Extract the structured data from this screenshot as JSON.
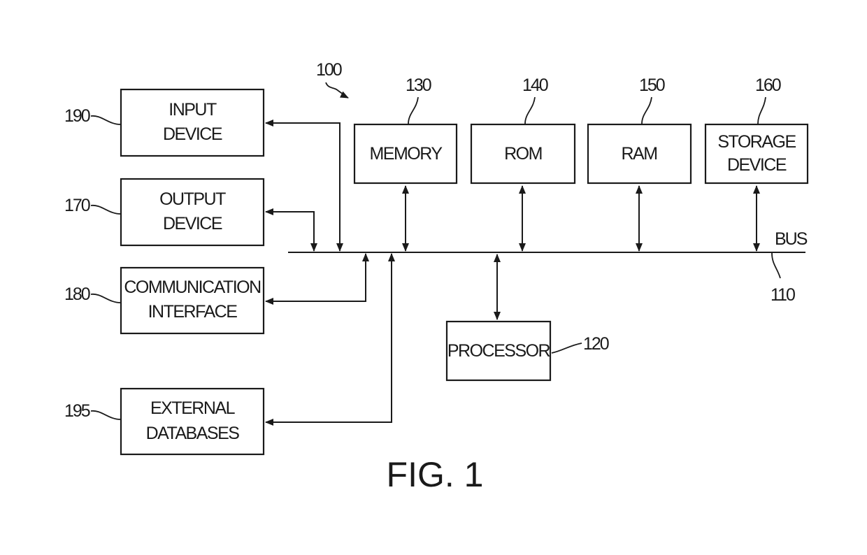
{
  "figure": {
    "caption": "FIG. 1",
    "system_ref": "100"
  },
  "bus": {
    "label": "BUS",
    "ref": "110"
  },
  "components": {
    "input_device": {
      "lines": [
        "INPUT",
        "DEVICE"
      ],
      "ref": "190"
    },
    "output_device": {
      "lines": [
        "OUTPUT",
        "DEVICE"
      ],
      "ref": "170"
    },
    "communication_interface": {
      "lines": [
        "COMMUNICATION",
        "INTERFACE"
      ],
      "ref": "180"
    },
    "external_databases": {
      "lines": [
        "EXTERNAL",
        "DATABASES"
      ],
      "ref": "195"
    },
    "memory": {
      "lines": [
        "MEMORY"
      ],
      "ref": "130"
    },
    "rom": {
      "lines": [
        "ROM"
      ],
      "ref": "140"
    },
    "ram": {
      "lines": [
        "RAM"
      ],
      "ref": "150"
    },
    "storage_device": {
      "lines": [
        "STORAGE",
        "DEVICE"
      ],
      "ref": "160"
    },
    "processor": {
      "lines": [
        "PROCESSOR"
      ],
      "ref": "120"
    }
  },
  "connections": [
    {
      "from": "input_device",
      "to": "bus",
      "direction": "bidirectional"
    },
    {
      "from": "output_device",
      "to": "bus",
      "direction": "bidirectional"
    },
    {
      "from": "communication_interface",
      "to": "bus",
      "direction": "bidirectional"
    },
    {
      "from": "external_databases",
      "to": "bus",
      "direction": "bidirectional"
    },
    {
      "from": "memory",
      "to": "bus",
      "direction": "bidirectional"
    },
    {
      "from": "rom",
      "to": "bus",
      "direction": "bidirectional"
    },
    {
      "from": "ram",
      "to": "bus",
      "direction": "bidirectional"
    },
    {
      "from": "storage_device",
      "to": "bus",
      "direction": "bidirectional"
    },
    {
      "from": "processor",
      "to": "bus",
      "direction": "bidirectional"
    }
  ]
}
